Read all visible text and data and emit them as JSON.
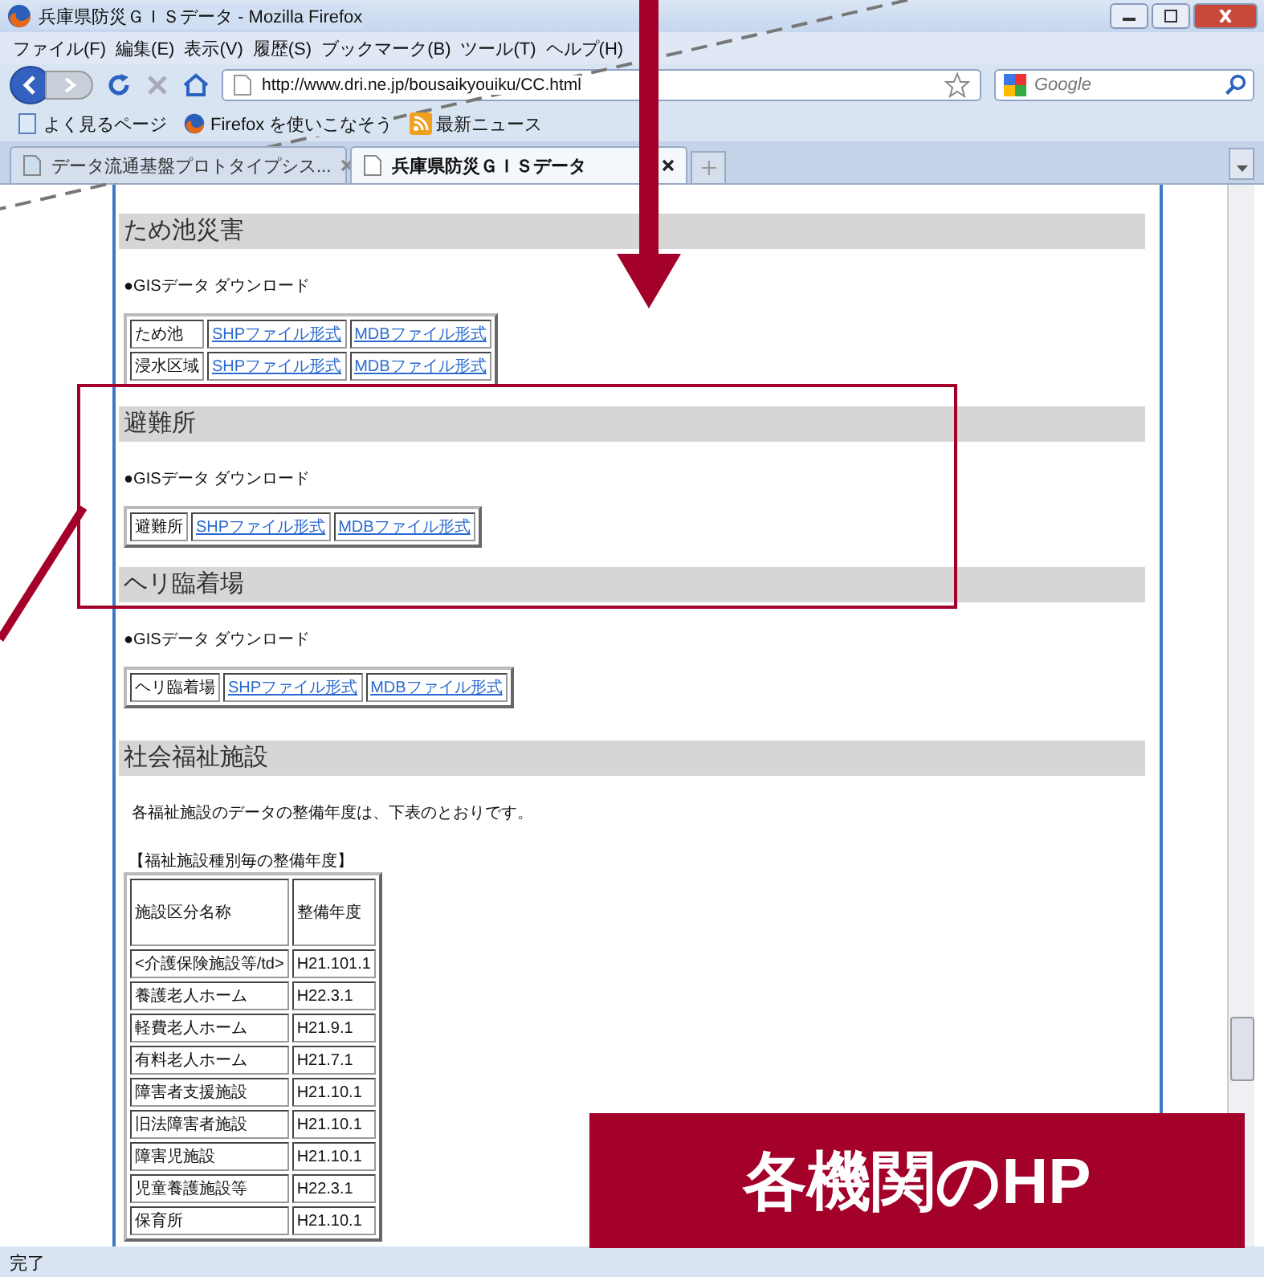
{
  "window": {
    "title": "兵庫県防災ＧＩＳデータ - Mozilla Firefox"
  },
  "menu": [
    "ファイル(F)",
    "編集(E)",
    "表示(V)",
    "履歴(S)",
    "ブックマーク(B)",
    "ツール(T)",
    "ヘルプ(H)"
  ],
  "address_bar": {
    "value": "http://www.dri.ne.jp/bousaikyouiku/CC.html"
  },
  "search": {
    "placeholder": "Google"
  },
  "bookmarks": [
    {
      "label": "よく見るページ",
      "kind": "page"
    },
    {
      "label": "Firefox を使いこなそう",
      "kind": "firefox"
    },
    {
      "label": "最新ニュース",
      "kind": "feed"
    }
  ],
  "tabs": [
    {
      "label": "データ流通基盤プロトタイプシス...",
      "selected": false
    },
    {
      "label": "兵庫県防災ＧＩＳデータ",
      "selected": true
    }
  ],
  "sections": [
    {
      "heading": "ため池災害",
      "download": "●GISデータ  ダウンロード",
      "rows": [
        {
          "label": "ため池",
          "links": [
            "SHPファイル形式",
            "MDBファイル形式"
          ]
        },
        {
          "label": "浸水区域",
          "links": [
            "SHPファイル形式",
            "MDBファイル形式"
          ]
        }
      ]
    },
    {
      "heading": "避難所",
      "download": "●GISデータ  ダウンロード",
      "rows": [
        {
          "label": "避難所",
          "links": [
            "SHPファイル形式",
            "MDBファイル形式"
          ]
        }
      ]
    },
    {
      "heading": "ヘリ臨着場",
      "download": "●GISデータ  ダウンロード",
      "rows": [
        {
          "label": "ヘリ臨着場",
          "links": [
            "SHPファイル形式",
            "MDBファイル形式"
          ]
        }
      ]
    }
  ],
  "welfare": {
    "heading": "社会福祉施設",
    "intro": "各福祉施設のデータの整備年度は、下表のとおりです。",
    "caption": "【福祉施設種別毎の整備年度】",
    "columns": [
      "施設区分名称",
      "整備年度"
    ],
    "rows": [
      [
        "<介護保険施設等/td>",
        "H21.101.1"
      ],
      [
        "養護老人ホーム",
        "H22.3.1"
      ],
      [
        "軽費老人ホーム",
        "H21.9.1"
      ],
      [
        "有料老人ホーム",
        "H21.7.1"
      ],
      [
        "障害者支援施設",
        "H21.10.1"
      ],
      [
        "旧法障害者施設",
        "H21.10.1"
      ],
      [
        "障害児施設",
        "H21.10.1"
      ],
      [
        "児童養護施設等",
        "H22.3.1"
      ],
      [
        "保育所",
        "H21.10.1"
      ]
    ]
  },
  "status_bar": "完了",
  "overlay_label": "各機関のHP"
}
